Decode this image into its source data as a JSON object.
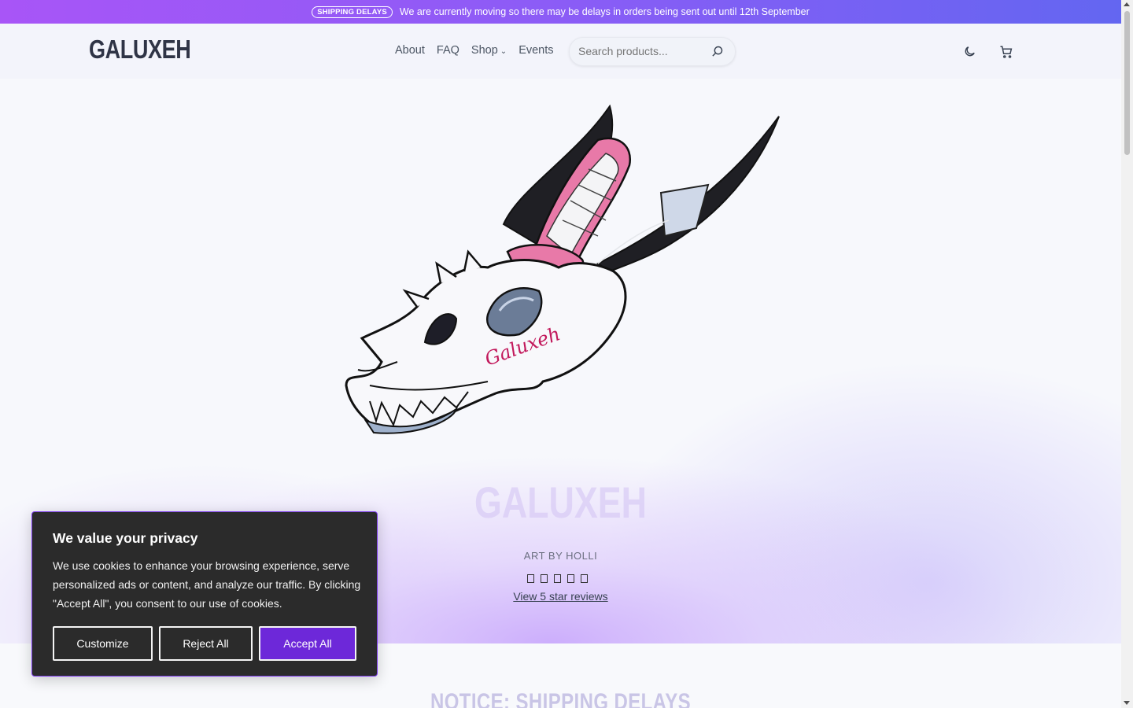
{
  "announcement": {
    "badge": "SHIPPING DELAYS",
    "text": "We are currently moving so there may be delays in orders being sent out until 12th September"
  },
  "header": {
    "logo": "GALUXEH",
    "nav": [
      "About",
      "FAQ",
      "Shop",
      "Events"
    ],
    "search_placeholder": "Search products...",
    "icons": [
      "search-icon",
      "moon-icon",
      "cart-icon"
    ]
  },
  "hero": {
    "image_signature": "Galuxeh",
    "title": "GALUXEH",
    "subtitle": "ART BY HOLLI",
    "rating_stars": 5,
    "reviews_link": "View 5 star reviews"
  },
  "below": {
    "notice_title": "NOTICE: SHIPPING DELAYS"
  },
  "cookie": {
    "title": "We value your privacy",
    "body": "We use cookies to enhance your browsing experience, serve personalized ads or content, and analyze our traffic. By clicking \"Accept All\", you consent to our use of cookies.",
    "customize": "Customize",
    "reject": "Reject All",
    "accept": "Accept All"
  },
  "colors": {
    "accent": "#6d28d9",
    "announce_gradient_start": "#a855f7",
    "announce_gradient_end": "#6366f1",
    "cookie_bg": "#2b2b2b"
  }
}
